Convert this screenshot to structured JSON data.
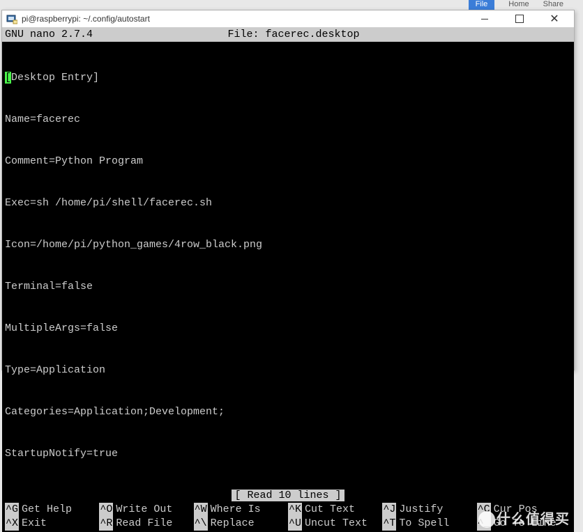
{
  "background_tabs": {
    "file": "File",
    "home": "Home",
    "share": "Share"
  },
  "window": {
    "title": "pi@raspberrypi: ~/.config/autostart"
  },
  "nano": {
    "version_label": "GNU nano 2.7.4",
    "file_label": "File: facerec.desktop",
    "status": "[ Read 10 lines ]"
  },
  "file_lines": [
    "[Desktop Entry]",
    "Name=facerec",
    "Comment=Python Program",
    "Exec=sh /home/pi/shell/facerec.sh",
    "Icon=/home/pi/python_games/4row_black.png",
    "Terminal=false",
    "MultipleArgs=false",
    "Type=Application",
    "Categories=Application;Development;",
    "StartupNotify=true"
  ],
  "shortcuts_row1": [
    {
      "key": "^G",
      "label": "Get Help"
    },
    {
      "key": "^O",
      "label": "Write Out"
    },
    {
      "key": "^W",
      "label": "Where Is"
    },
    {
      "key": "^K",
      "label": "Cut Text"
    },
    {
      "key": "^J",
      "label": "Justify"
    },
    {
      "key": "^C",
      "label": "Cur Pos"
    }
  ],
  "shortcuts_row2": [
    {
      "key": "^X",
      "label": "Exit"
    },
    {
      "key": "^R",
      "label": "Read File"
    },
    {
      "key": "^\\",
      "label": "Replace"
    },
    {
      "key": "^U",
      "label": "Uncut Text"
    },
    {
      "key": "^T",
      "label": "To Spell"
    },
    {
      "key": "^_",
      "label": "Go To Line"
    }
  ],
  "watermark": "什么值得买"
}
